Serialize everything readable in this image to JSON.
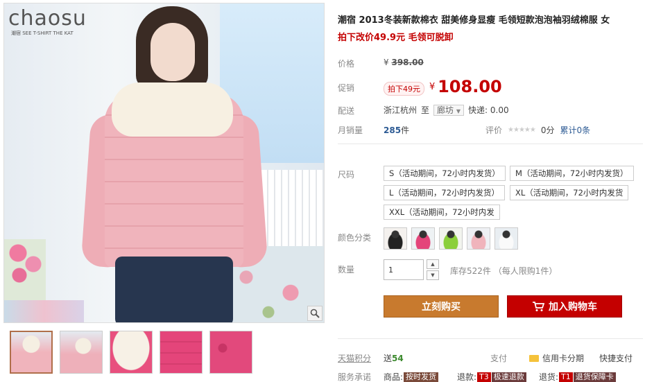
{
  "logo": {
    "brand": "chaosu",
    "tagline": "潮宿 SEE T-SHIRT THE KAT"
  },
  "product": {
    "title": "潮宿 2013冬装新款棉衣 甜美修身显瘦 毛领短款泡泡袖羽绒棉服 女",
    "subtitle": "拍下改价49.9元 毛领可脱卸"
  },
  "price": {
    "label": "价格",
    "currency": "¥",
    "original": "398.00",
    "promo_label": "促销",
    "promo_tag": "拍下49元",
    "current": "108.00"
  },
  "shipping": {
    "label": "配送",
    "from": "浙江杭州",
    "to_word": "至",
    "to_city": "廊坊",
    "fee": "快递: 0.00"
  },
  "sales": {
    "label": "月销量",
    "count": "285",
    "unit": "件"
  },
  "rating": {
    "label": "评价",
    "stars": "★★★★★",
    "score": "0分",
    "cumulative": "累计0条"
  },
  "sizes": {
    "label": "尺码",
    "options": [
      "S（活动期间，72小时内发货）",
      "M（活动期间，72小时内发货）",
      "L（活动期间，72小时内发货）",
      "XL（活动期间，72小时内发货",
      "XXL（活动期间，72小时内发"
    ]
  },
  "colors": {
    "label": "颜色分类",
    "swatch_count": 5
  },
  "quantity": {
    "label": "数量",
    "value": "1",
    "stock": "库存522件 （每人限购1件）"
  },
  "actions": {
    "buy_now": "立刻购买",
    "add_to_cart": "加入购物车"
  },
  "points": {
    "label": "天猫积分",
    "prefix": "送",
    "value": "54"
  },
  "payment": {
    "label": "支付",
    "credit": "信用卡分期",
    "quick": "快捷支付"
  },
  "promise": {
    "label": "服务承诺",
    "items": [
      {
        "prefix": "商品:",
        "chip": "按时发货"
      },
      {
        "prefix": "退款:",
        "chip_code": "T3",
        "chip": "极速退款"
      },
      {
        "prefix": "退货:",
        "chip_code": "T1",
        "chip": "退货保障卡"
      }
    ]
  }
}
